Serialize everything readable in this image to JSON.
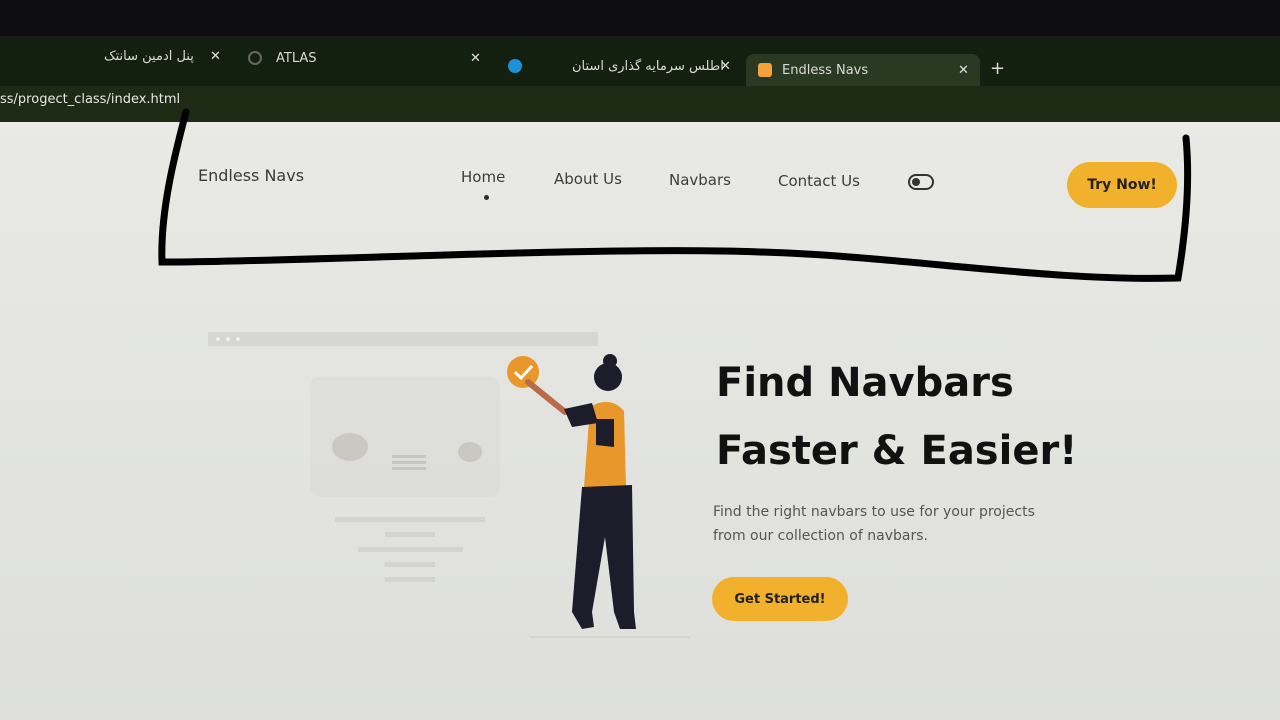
{
  "browser": {
    "tabs": [
      {
        "title": "پنل ادمین سانتک",
        "close": "✕",
        "active": false
      },
      {
        "title": "ATLAS",
        "close": "✕",
        "active": false
      },
      {
        "title": "اطلس سرمایه گذاری استان",
        "close": "✕",
        "active": false
      },
      {
        "title": "Endless Navs",
        "close": "✕",
        "active": true
      }
    ],
    "new_tab_icon": "+",
    "url": "ss/progect_class/index.html"
  },
  "navbar": {
    "brand": "Endless Navs",
    "links": [
      "Home",
      "About Us",
      "Navbars",
      "Contact Us"
    ],
    "active_link": "Home",
    "cta_label": "Try Now!"
  },
  "hero": {
    "title_line1": "Find Navbars",
    "title_line2": "Faster & Easier!",
    "description_line1": "Find the right navbars to use for your projects",
    "description_line2": "from our collection of navbars.",
    "cta_label": "Get Started!"
  },
  "colors": {
    "accent": "#f2b12c",
    "marker": "#000000"
  },
  "icons": {
    "theme_toggle": "toggle-icon",
    "check": "check-icon"
  }
}
